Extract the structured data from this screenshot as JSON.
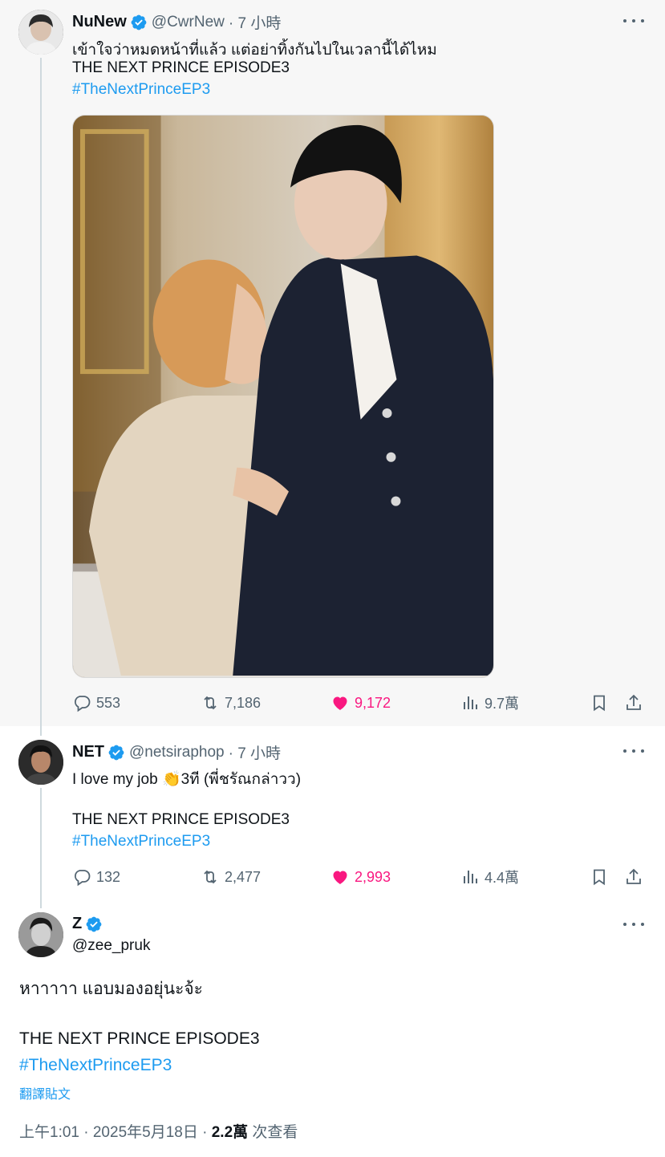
{
  "colors": {
    "accent": "#1d9bf0",
    "like": "#f91880",
    "muted": "#536471",
    "text": "#0f1419"
  },
  "posts": [
    {
      "display_name": "NuNew",
      "handle": "@CwrNew",
      "time": "· 7 小時",
      "lines": [
        "เข้าใจว่าหมดหน้าที่แล้ว แต่อย่าทิ้งกันไปในเวลานี้ได้ไหม",
        "THE NEXT PRINCE EPISODE3"
      ],
      "hashtag": "#TheNextPrinceEP3",
      "stats": {
        "replies": "553",
        "reposts": "7,186",
        "likes": "9,172",
        "views": "9.7萬"
      }
    },
    {
      "display_name": "NET",
      "handle": "@netsiraphop",
      "time": "· 7 小時",
      "line1_pre": "I love my job ",
      "line1_emoji": "👏",
      "line1_post": "3ที (พี่ชรัณกล่าวว)",
      "line2": "THE NEXT PRINCE EPISODE3",
      "hashtag": "#TheNextPrinceEP3",
      "stats": {
        "replies": "132",
        "reposts": "2,477",
        "likes": "2,993",
        "views": "4.4萬"
      }
    },
    {
      "display_name": "Z",
      "handle": "@zee_pruk",
      "line1": "หาาาาา แอบมองอยุ่นะจ้ะ",
      "line2": "THE NEXT PRINCE EPISODE3",
      "hashtag": "#TheNextPrinceEP3",
      "translate": "翻譯貼文",
      "timestamp": "上午1:01 · 2025年5月18日 · ",
      "views_count": "2.2萬",
      "views_label": " 次查看"
    }
  ],
  "icons": [
    "verified-badge-icon",
    "more-icon",
    "reply-icon",
    "repost-icon",
    "heart-icon",
    "views-icon",
    "bookmark-icon",
    "share-icon"
  ]
}
